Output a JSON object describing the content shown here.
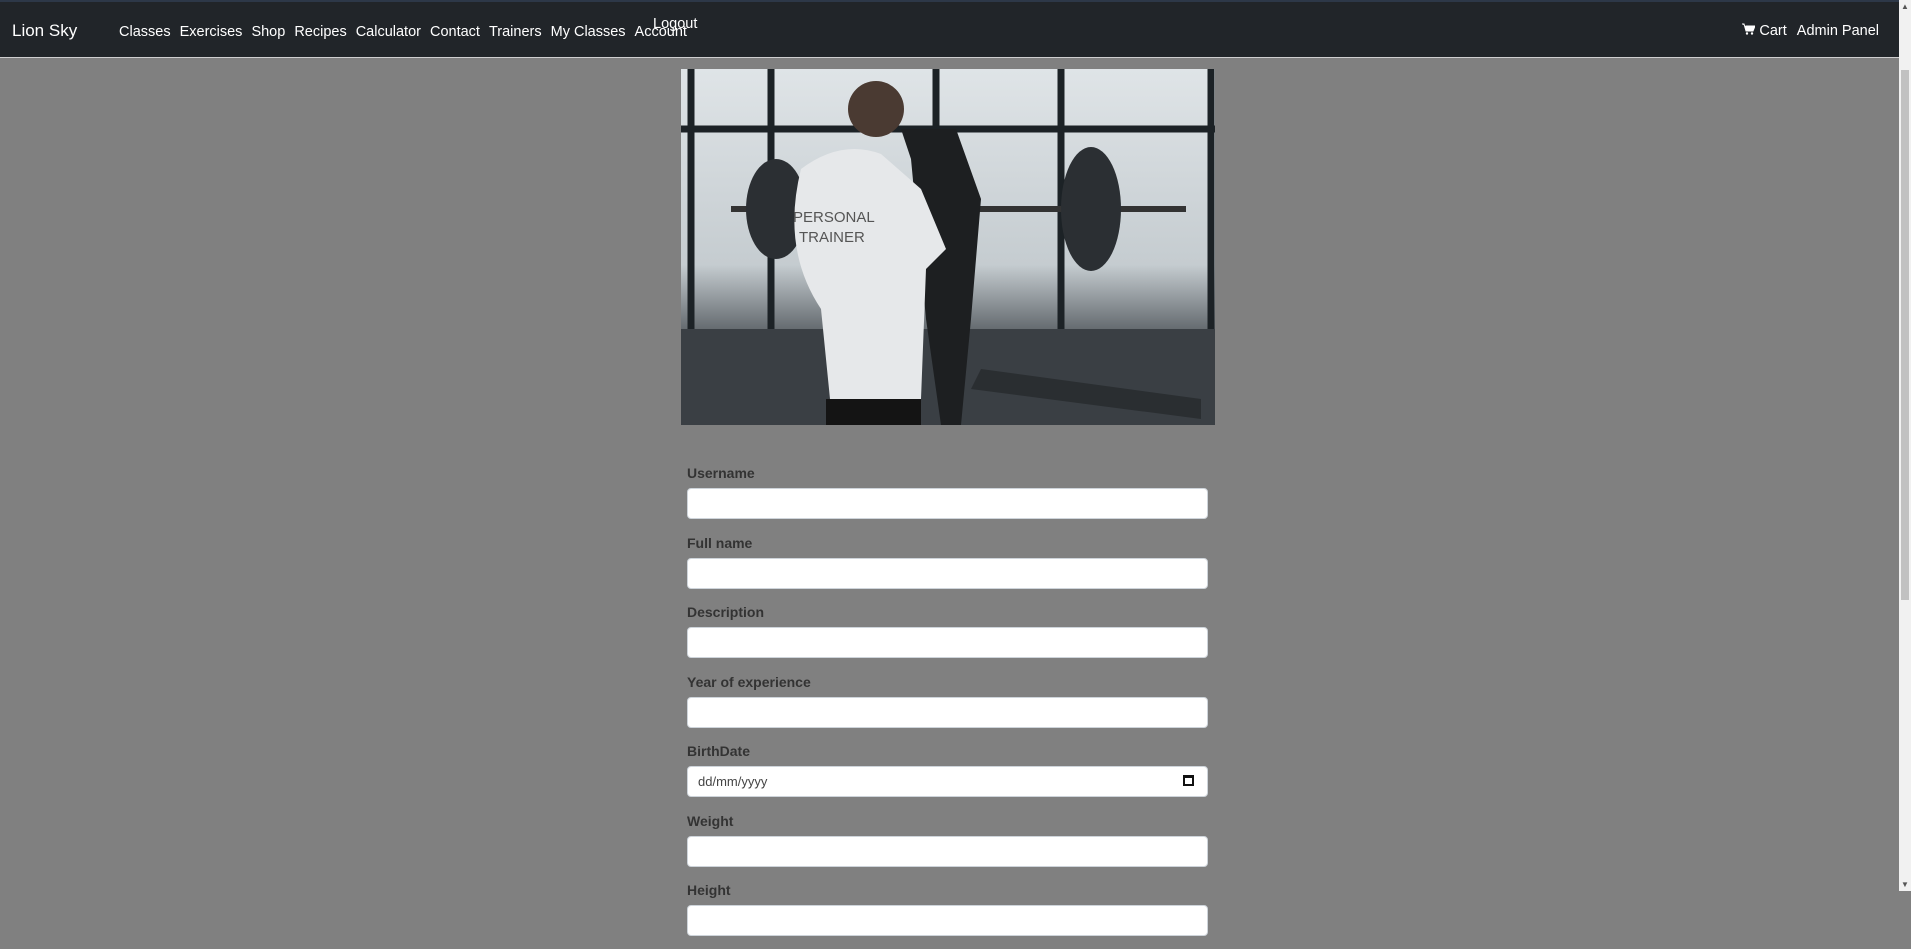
{
  "navbar": {
    "brand": "Lion Sky",
    "links": [
      "Classes",
      "Exercises",
      "Shop",
      "Recipes",
      "Calculator",
      "Contact",
      "Trainers",
      "My Classes",
      "Account"
    ],
    "logout": "Logout",
    "cart": "Cart",
    "cart_icon": "shopping-cart-icon",
    "admin": "Admin Panel"
  },
  "hero_image": {
    "subject": "personal trainer with client at barbell",
    "shirt_text": "PERSONAL TRAINER"
  },
  "form": {
    "fields": [
      {
        "label": "Username",
        "value": ""
      },
      {
        "label": "Full name",
        "value": ""
      },
      {
        "label": "Description",
        "value": ""
      },
      {
        "label": "Year of experience",
        "value": ""
      },
      {
        "label": "BirthDate",
        "placeholder": "dd/mm/yyyy"
      },
      {
        "label": "Weight",
        "value": ""
      },
      {
        "label": "Height",
        "value": ""
      }
    ]
  },
  "colors": {
    "navbar": "#212529",
    "background": "#808080"
  }
}
